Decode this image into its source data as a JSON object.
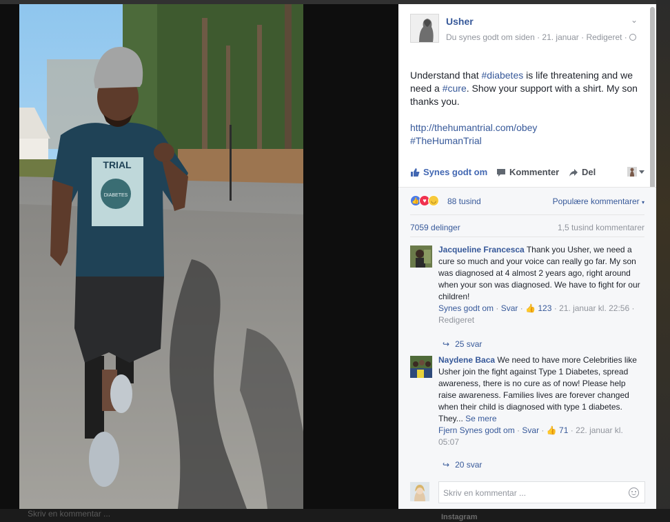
{
  "background": {
    "bottom_text": "Skriv en kommentar ...",
    "bottom_right_text": "Instagram"
  },
  "post": {
    "page_name": "Usher",
    "meta_line": "Du synes godt om siden · 21. januar · Redigeret ·",
    "audience_icon": "globe-icon",
    "text_line_1_a": "Understand that ",
    "hashtag_1": "#diabetes",
    "text_line_1_b": " is life threatening and we need a ",
    "hashtag_2": "#cure",
    "text_line_1_c": ". Show your support with a shirt. My son thanks you.",
    "link": "http://thehumantrial.com/obey",
    "hashtag_3": "#TheHumanTrial"
  },
  "actions": {
    "like": "Synes godt om",
    "comment": "Kommenter",
    "share": "Del"
  },
  "stats": {
    "reactions_count": "88 tusind",
    "sort_label": "Populære kommentarer",
    "shares": "7059 delinger",
    "comments": "1,5 tusind kommentarer"
  },
  "comments": [
    {
      "author": "Jacqueline Francesca",
      "text": " Thank you Usher, we need a cure so much and your voice can really go far. My son was diagnosed at 4 almost 2 years ago, right around when your son was diagnosed. We have to fight for our children!",
      "like_action": "Synes godt om",
      "reply_action": "Svar",
      "likes": "123",
      "timestamp": "21. januar kl. 22:56",
      "edited": "Redigeret",
      "replies": "25 svar"
    },
    {
      "author": "Naydene Baca",
      "text": " We need to have more Celebrities like Usher join the fight against Type 1 Diabetes, spread awareness, there is no cure as of now! Please help raise awareness. Families lives are forever changed when their child is diagnosed with type 1 diabetes. They...",
      "see_more": "Se mere",
      "like_action": "Fjern Synes godt om",
      "reply_action": "Svar",
      "likes": "71",
      "timestamp": "22. januar kl. 05:07",
      "replies": "20 svar"
    }
  ],
  "composer": {
    "placeholder": "Skriv en kommentar ..."
  },
  "colors": {
    "link": "#365899",
    "like_active": "#4267b2",
    "meta": "#90949c"
  }
}
